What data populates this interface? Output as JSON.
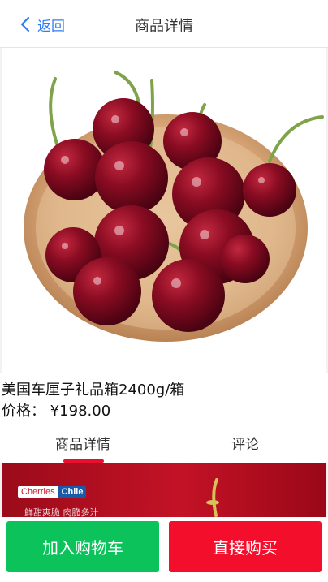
{
  "header": {
    "back_label": "返回",
    "title": "商品详情"
  },
  "product": {
    "name": "美国车厘子礼品箱2400g/箱",
    "price_label": "价格：",
    "price": "¥198.00",
    "image": "cherries-bowl-photo"
  },
  "tabs": [
    {
      "label": "商品详情",
      "active": true
    },
    {
      "label": "评论",
      "active": false
    }
  ],
  "banner": {
    "logo_left": "Cherries",
    "logo_right": "Chile",
    "tagline": "鲜甜爽脆  肉脆多汁"
  },
  "actions": {
    "add_to_cart": "加入购物车",
    "buy_now": "直接购买"
  },
  "colors": {
    "accent_blue": "#2f7cf6",
    "cart_green": "#0bc25b",
    "buy_red": "#f30e2c",
    "tab_indicator": "#e8102c"
  }
}
